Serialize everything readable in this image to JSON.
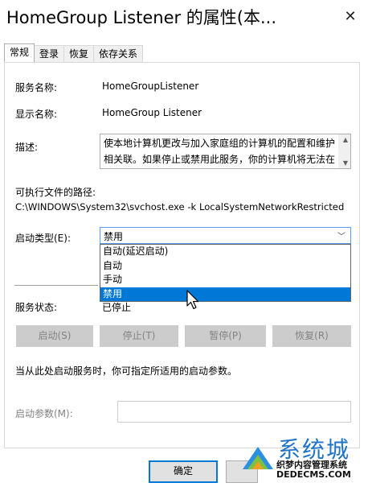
{
  "window": {
    "title": "HomeGroup Listener 的属性(本...",
    "close_glyph": "✕"
  },
  "tabs": [
    {
      "label": "常规",
      "active": true
    },
    {
      "label": "登录",
      "active": false
    },
    {
      "label": "恢复",
      "active": false
    },
    {
      "label": "依存关系",
      "active": false
    }
  ],
  "general": {
    "service_name_label": "服务名称:",
    "service_name": "HomeGroupListener",
    "display_name_label": "显示名称:",
    "display_name": "HomeGroup Listener",
    "description_label": "描述:",
    "description": "使本地计算机更改与加入家庭组的计算机的配置和维护相关联。如果停止或禁用此服务，你的计算机将无法在",
    "exe_path_label": "可执行文件的路径:",
    "exe_path": "C:\\WINDOWS\\System32\\svchost.exe -k LocalSystemNetworkRestricted",
    "startup_type_label": "启动类型(E):",
    "startup_type_value": "禁用",
    "startup_options": [
      "自动(延迟启动)",
      "自动",
      "手动",
      "禁用"
    ],
    "status_label": "服务状态:",
    "status_value": "已停止",
    "buttons": {
      "start": "启动(S)",
      "stop": "停止(T)",
      "pause": "暂停(P)",
      "resume": "恢复(R)"
    },
    "hint": "当从此处启动服务时，你可指定所适用的启动参数。",
    "param_label": "启动参数(M):",
    "param_value": ""
  },
  "footer": {
    "ok": "确定"
  },
  "watermark": {
    "big": "系统城",
    "cn": "织梦内容管理系统",
    "url": "DEDECMS.COM"
  },
  "colors": {
    "accent": "#0078d7",
    "disabled_text": "#838383"
  }
}
